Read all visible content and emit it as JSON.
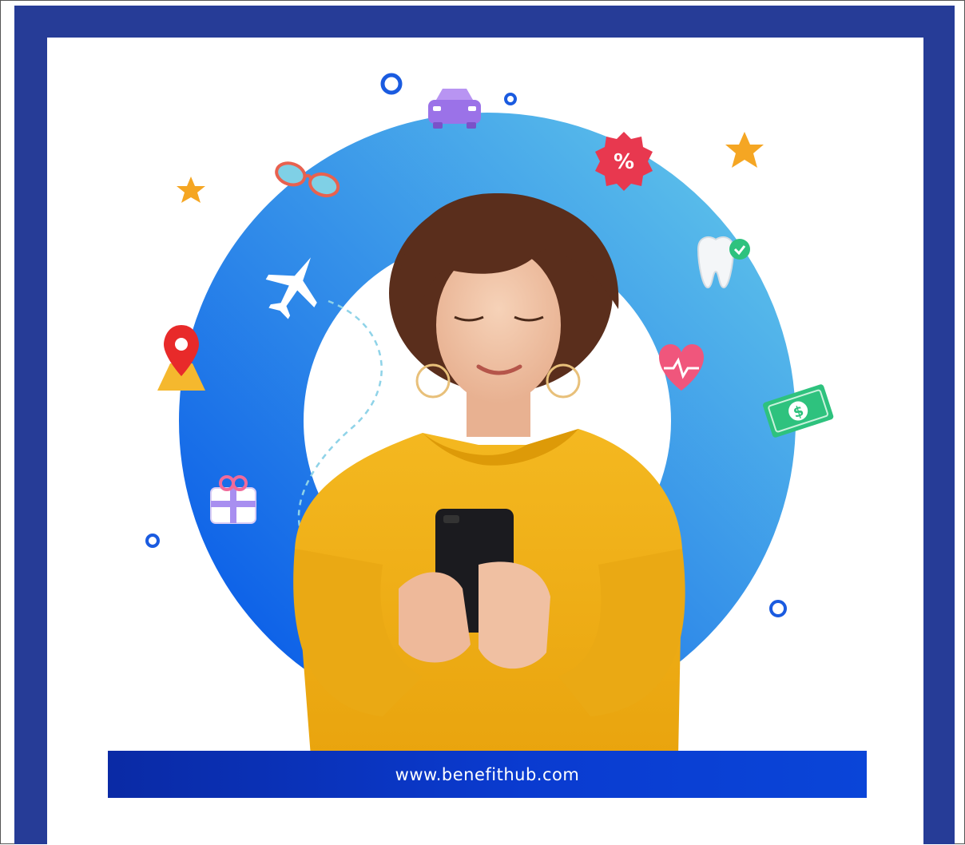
{
  "banner": {
    "url": "www.benefithub.com"
  },
  "icons": [
    "airplane-icon",
    "car-icon",
    "glasses-icon",
    "discount-badge-icon",
    "star-icon",
    "tooth-icon",
    "map-pin-icon",
    "heart-health-icon",
    "dollar-bill-icon",
    "gift-icon",
    "circle-dot-icon"
  ],
  "colors": {
    "frame": "#263c97",
    "ring_start": "#0a5de8",
    "ring_end": "#5cc0ea",
    "sweater": "#f2b21a",
    "banner": "#0a2aa5"
  }
}
